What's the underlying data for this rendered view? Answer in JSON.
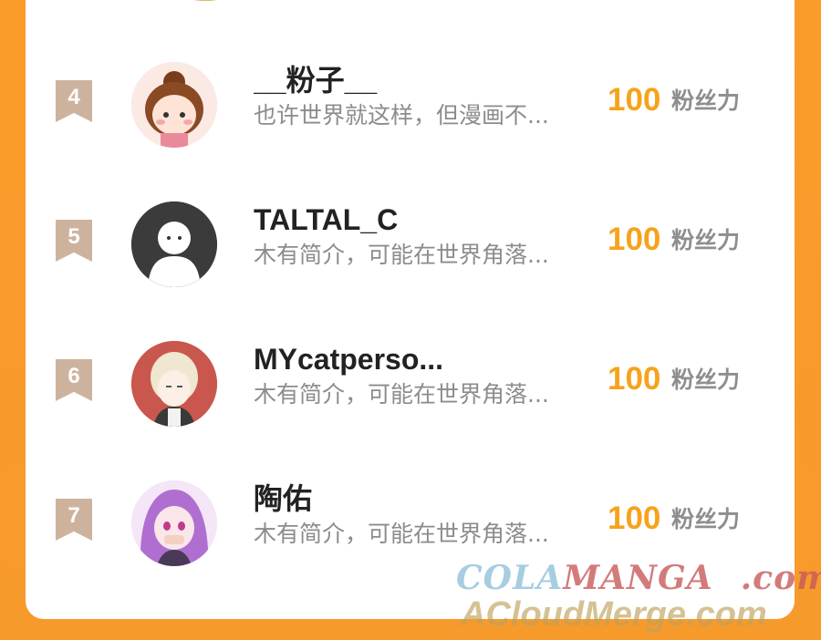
{
  "rows": [
    {
      "rank": "4",
      "name": "__粉子__",
      "bio": "也许世界就这样，但漫画不...",
      "score": "100",
      "unit": "粉丝力"
    },
    {
      "rank": "5",
      "name": "TALTAL_C",
      "bio": "木有简介，可能在世界角落...",
      "score": "100",
      "unit": "粉丝力"
    },
    {
      "rank": "6",
      "name": "MYcatperso...",
      "bio": "木有简介，可能在世界角落...",
      "score": "100",
      "unit": "粉丝力"
    },
    {
      "rank": "7",
      "name": "陶佑",
      "bio": "木有简介，可能在世界角落...",
      "score": "100",
      "unit": "粉丝力"
    }
  ],
  "watermark": {
    "line1_a": "COLA",
    "line1_b": "MANGA",
    "line1_c": ".com",
    "line2": "ACloudMerge.com"
  },
  "colors": {
    "background": "#fb9b2a",
    "score": "#f6a31c",
    "rank_badge": "#cdb39e"
  }
}
